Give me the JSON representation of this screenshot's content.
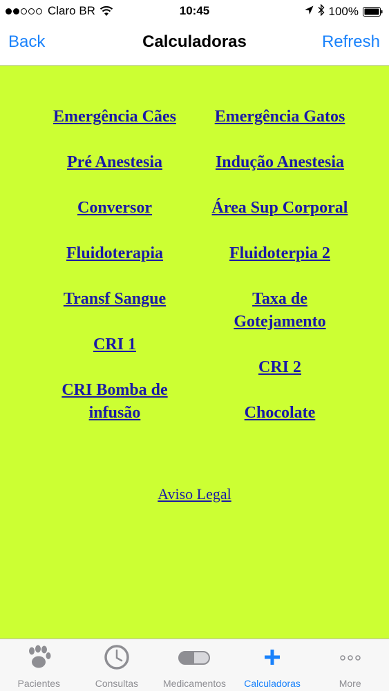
{
  "status_bar": {
    "carrier": "Claro BR",
    "time": "10:45",
    "battery": "100%",
    "signal_bars": 2,
    "signal_total": 5
  },
  "nav": {
    "back_label": "Back",
    "title": "Calculadoras",
    "refresh_label": "Refresh"
  },
  "calculators": {
    "left": [
      "Emergência Cães",
      "Pré Anestesia",
      "Conversor",
      "Fluidoterapia",
      "Transf Sangue",
      "CRI 1",
      "CRI Bomba de infusão"
    ],
    "right": [
      "Emergência Gatos",
      "Indução Anestesia",
      "Área Sup Corporal",
      "Fluidoterpia 2",
      "Taxa de Gotejamento",
      "CRI 2",
      "Chocolate"
    ]
  },
  "legal_link": "Aviso Legal",
  "tabs": [
    {
      "label": "Pacientes",
      "icon": "paw-icon",
      "active": false
    },
    {
      "label": "Consultas",
      "icon": "clock-icon",
      "active": false
    },
    {
      "label": "Medicamentos",
      "icon": "pill-icon",
      "active": false
    },
    {
      "label": "Calculadoras",
      "icon": "plus-icon",
      "active": true
    },
    {
      "label": "More",
      "icon": "more-icon",
      "active": false
    }
  ],
  "colors": {
    "background": "#ccff33",
    "link": "#1a1aa6",
    "accent": "#1a82fb",
    "tab_inactive": "#8e8e93"
  }
}
